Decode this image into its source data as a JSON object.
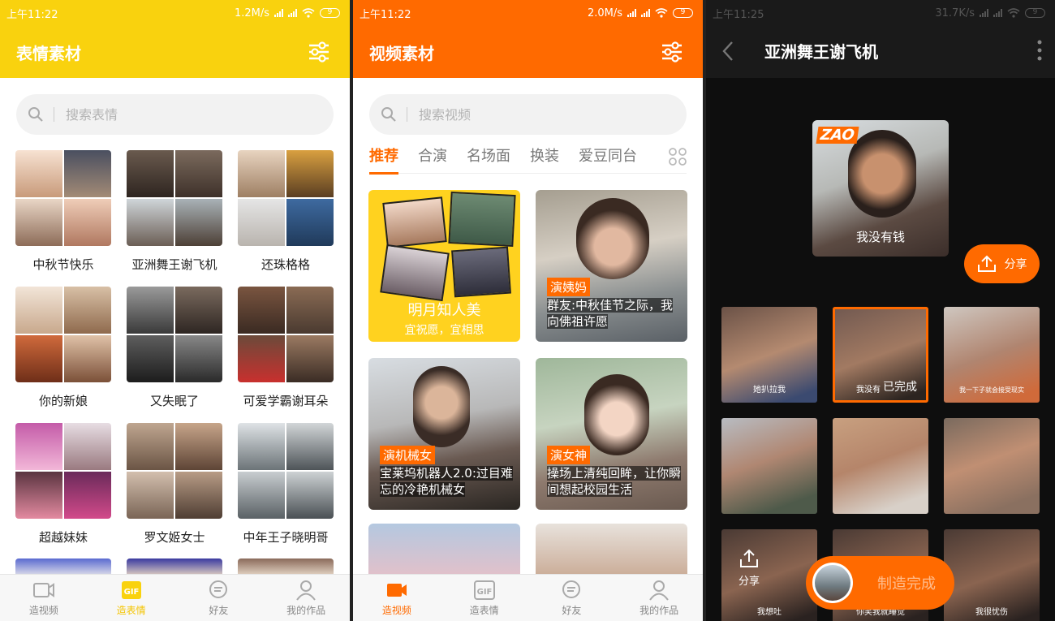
{
  "panel1": {
    "status": {
      "time": "上午11:22",
      "speed": "1.2M/s",
      "battery": "9"
    },
    "title": "表情素材",
    "search_placeholder": "搜索表情",
    "stickers": [
      {
        "label": "中秋节快乐"
      },
      {
        "label": "亚洲舞王谢飞机"
      },
      {
        "label": "还珠格格"
      },
      {
        "label": "你的新娘"
      },
      {
        "label": "又失眠了"
      },
      {
        "label": "可爱学霸谢耳朵"
      },
      {
        "label": "超越妹妹"
      },
      {
        "label": "罗文姬女士"
      },
      {
        "label": "中年王子晓明哥"
      }
    ],
    "tabs": [
      {
        "label": "造视频",
        "icon": "video-camera-icon"
      },
      {
        "label": "造表情",
        "icon": "gif-icon"
      },
      {
        "label": "好友",
        "icon": "chat-bubble-icon"
      },
      {
        "label": "我的作品",
        "icon": "person-icon"
      }
    ],
    "accent": "#f9d20e"
  },
  "panel2": {
    "status": {
      "time": "上午11:22",
      "speed": "2.0M/s",
      "battery": "9"
    },
    "title": "视频素材",
    "search_placeholder": "搜索视频",
    "categories": [
      "推荐",
      "合演",
      "名场面",
      "换装",
      "爱豆同台"
    ],
    "videos": [
      {
        "title": "明月知人美",
        "subtitle": "宜祝愿，宜相思"
      },
      {
        "tag": "演姨妈",
        "desc": "群友:中秋佳节之际，我向佛祖许愿"
      },
      {
        "tag": "演机械女",
        "desc": "宝莱坞机器人2.0:过目难忘的冷艳机械女"
      },
      {
        "tag": "演女神",
        "desc": "操场上清纯回眸，让你瞬间想起校园生活"
      }
    ],
    "tabs": [
      {
        "label": "造视频",
        "icon": "video-camera-icon"
      },
      {
        "label": "造表情",
        "icon": "gif-icon"
      },
      {
        "label": "好友",
        "icon": "chat-bubble-icon"
      },
      {
        "label": "我的作品",
        "icon": "person-icon"
      }
    ],
    "accent": "#ff6a00"
  },
  "panel3": {
    "status": {
      "time": "上午11:25",
      "speed": "31.7K/s",
      "battery": "9"
    },
    "title": "亚洲舞王谢飞机",
    "preview_logo": "ZAO",
    "preview_caption": "我没有钱",
    "share_label": "分享",
    "frames": [
      {
        "caption": "她扒拉我"
      },
      {
        "caption": "我没有",
        "status": "已完成"
      },
      {
        "caption": "我一下子就会接受现实"
      },
      {
        "caption": ""
      },
      {
        "caption": ""
      },
      {
        "caption": ""
      },
      {
        "caption": "我想吐"
      },
      {
        "caption": "你笑我就睡觉"
      },
      {
        "caption": "我很忧伤"
      }
    ],
    "bottom_share": "分享",
    "make_label": "制造完成"
  }
}
